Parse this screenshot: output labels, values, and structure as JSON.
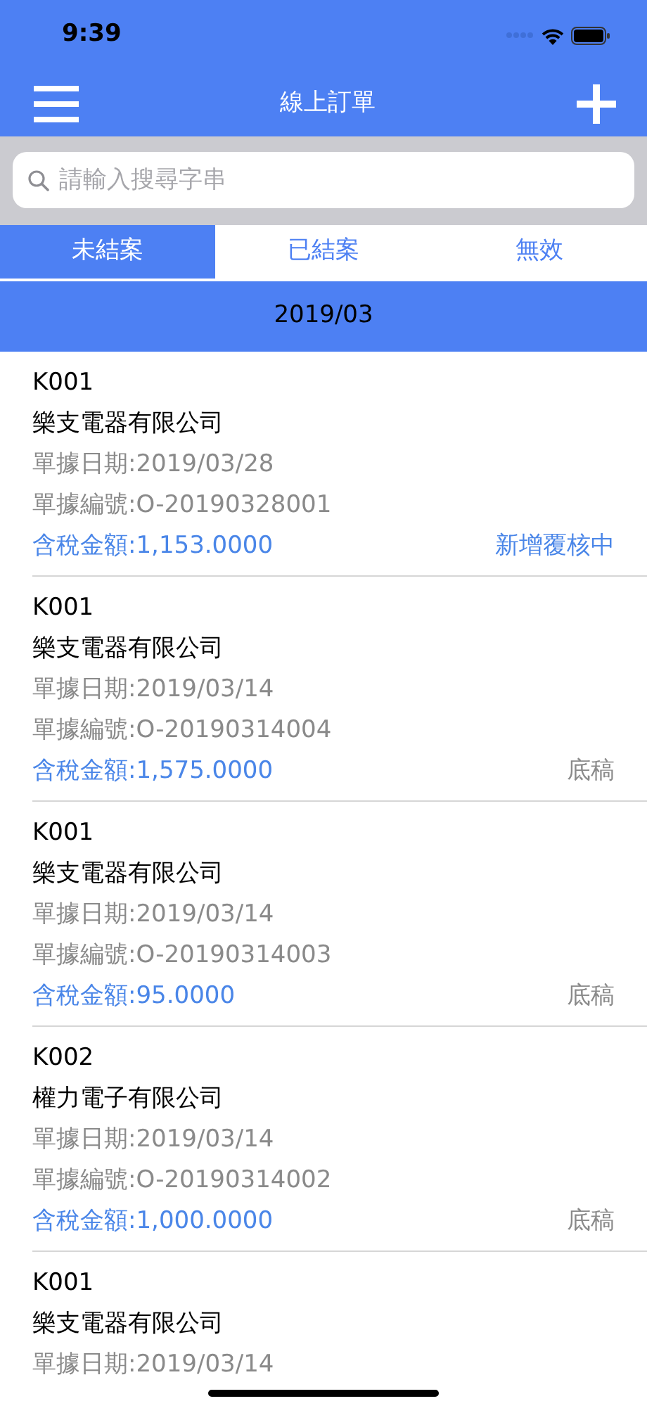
{
  "status_bar": {
    "time": "9:39"
  },
  "nav": {
    "title": "線上訂單"
  },
  "search": {
    "placeholder": "請輸入搜尋字串"
  },
  "tabs": [
    {
      "label": "未結案",
      "selected": true
    },
    {
      "label": "已結案",
      "selected": false
    },
    {
      "label": "無效",
      "selected": false
    }
  ],
  "section_header": "2019/03",
  "orders": [
    {
      "code": "K001",
      "company": "樂支電器有限公司",
      "date": "單據日期:2019/03/28",
      "number": "單據編號:O-20190328001",
      "amount": "含稅金額:1,153.0000",
      "status": "新增覆核中",
      "kind": "review"
    },
    {
      "code": "K001",
      "company": "樂支電器有限公司",
      "date": "單據日期:2019/03/14",
      "number": "單據編號:O-20190314004",
      "amount": "含稅金額:1,575.0000",
      "status": "底稿",
      "kind": "draft"
    },
    {
      "code": "K001",
      "company": "樂支電器有限公司",
      "date": "單據日期:2019/03/14",
      "number": "單據編號:O-20190314003",
      "amount": "含稅金額:95.0000",
      "status": "底稿",
      "kind": "draft"
    },
    {
      "code": "K002",
      "company": "權力電子有限公司",
      "date": "單據日期:2019/03/14",
      "number": "單據編號:O-20190314002",
      "amount": "含稅金額:1,000.0000",
      "status": "底稿",
      "kind": "draft"
    },
    {
      "code": "K001",
      "company": "樂支電器有限公司",
      "date": "單據日期:2019/03/14"
    }
  ]
}
